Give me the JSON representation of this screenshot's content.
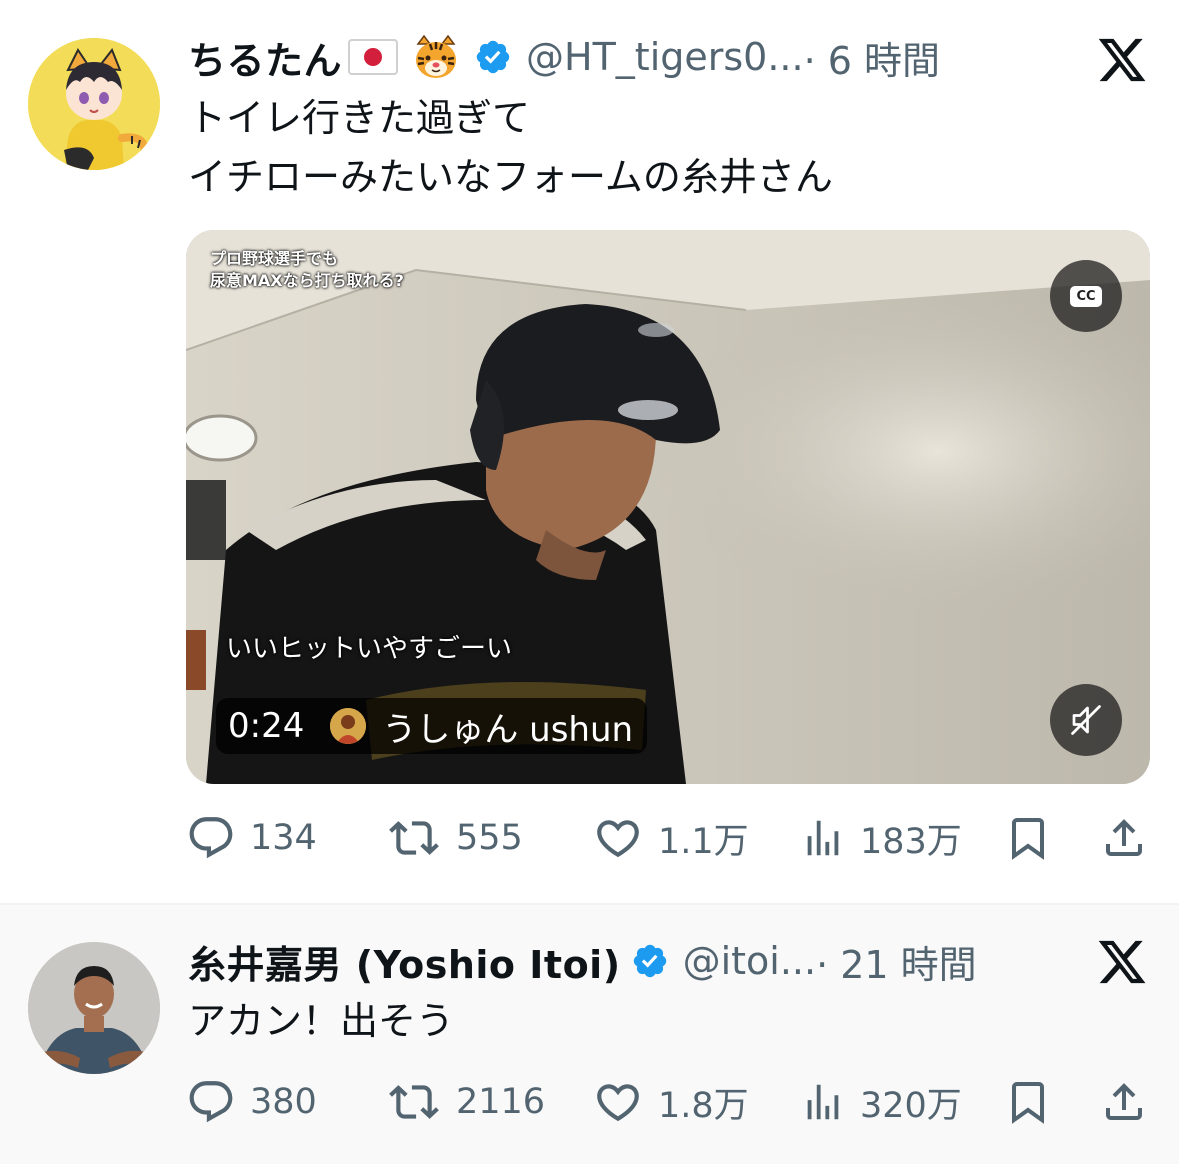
{
  "tweets": [
    {
      "author_name": "ちるたん",
      "author_handle": "@HT_tigers0...",
      "time": "· 6 時間",
      "text_lines": [
        "トイレ行きた過ぎて",
        "イチローみたいなフォームの糸井さん"
      ],
      "media": {
        "overlay_caption_lines": [
          "プロ野球選手でも",
          "尿意MAXなら打ち取れる?"
        ],
        "subtitle": "いいヒットいやすごーい",
        "duration": "0:24",
        "source_name": "うしゅん ushun",
        "cc_label": "CC"
      },
      "stats": {
        "replies": "134",
        "reposts": "555",
        "likes": "1.1万",
        "views": "183万"
      }
    },
    {
      "author_name": "糸井嘉男 (Yoshio Itoi)",
      "author_handle": "@itoi...",
      "time": "· 21 時間",
      "text_lines": [
        "アカン！出そう"
      ],
      "stats": {
        "replies": "380",
        "reposts": "2116",
        "likes": "1.8万",
        "views": "320万"
      }
    }
  ],
  "colors": {
    "verified": "#1d9bf0",
    "secondary_text": "#536471",
    "primary_text": "#0f1419",
    "avatar1_bg": "#f3dc57"
  },
  "icons": [
    "reply-icon",
    "repost-icon",
    "like-icon",
    "views-icon",
    "bookmark-icon",
    "share-icon",
    "verified-icon",
    "x-logo-icon",
    "cc-icon",
    "mute-icon"
  ]
}
